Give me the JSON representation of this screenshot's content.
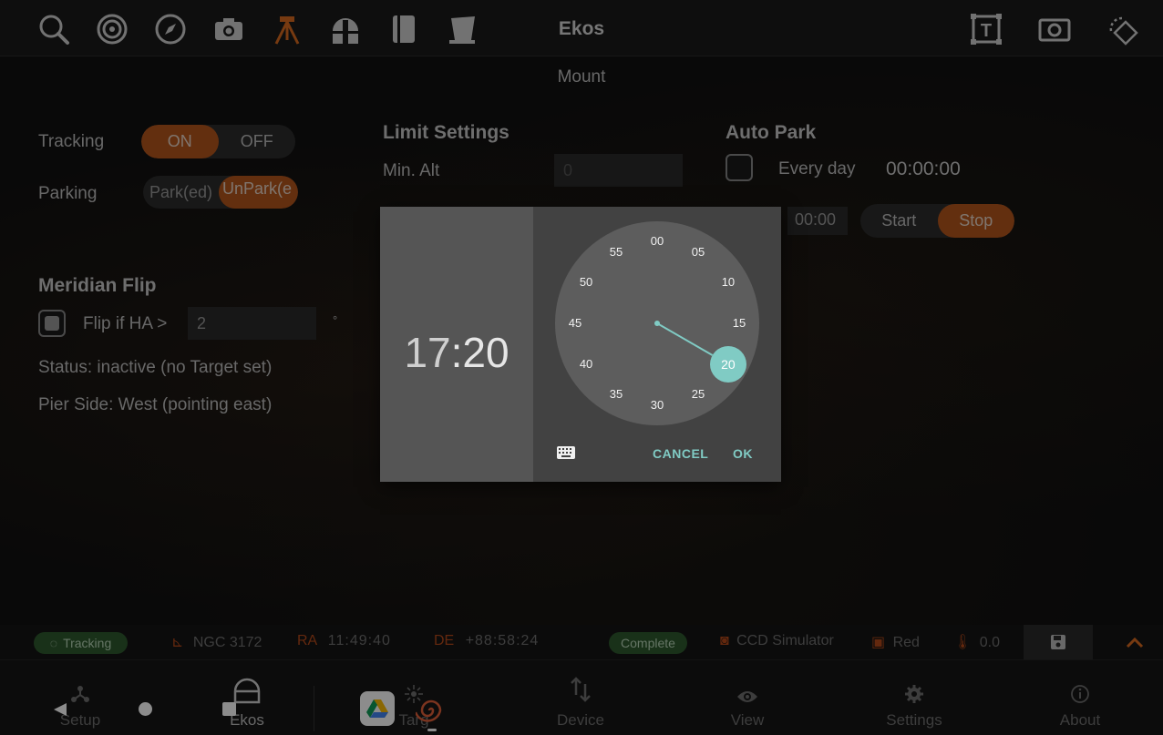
{
  "topbar": {
    "title": "Ekos",
    "icons": [
      "search-icon",
      "target-icon",
      "compass-icon",
      "camera-icon",
      "tripod-icon",
      "dome-icon",
      "notebook-icon",
      "flat-panel-icon",
      "text-frame-icon",
      "screen-capture-icon",
      "rotate-icon"
    ],
    "accent": "#d96a1f"
  },
  "page": {
    "subtitle": "Mount"
  },
  "tracking": {
    "label": "Tracking",
    "on": "ON",
    "off": "OFF"
  },
  "parking": {
    "label": "Parking",
    "park": "Park(ed)",
    "unpark": "UnPark(e"
  },
  "limits": {
    "heading": "Limit Settings",
    "min_alt_label": "Min. Alt",
    "min_alt_value": "0"
  },
  "autopark": {
    "heading": "Auto Park",
    "every_day": "Every day",
    "time": "00:00:00",
    "short_time": "00:00",
    "start": "Start",
    "stop": "Stop"
  },
  "meridian": {
    "heading": "Meridian Flip",
    "flip_label": "Flip if HA >",
    "flip_value": "2",
    "degree": "°",
    "status": "Status: inactive (no Target set)",
    "pier": "Pier Side: West (pointing east)"
  },
  "status": {
    "tracking": "Tracking",
    "target": "NGC 3172",
    "ra_label": "RA",
    "ra": "11:49:40",
    "de_label": "DE",
    "de": "+88:58:24",
    "complete": "Complete",
    "ccd": "CCD Simulator",
    "filter": "Red",
    "temp": "0.0"
  },
  "nav": {
    "setup": "Setup",
    "ekos": "Ekos",
    "target": "Targ",
    "device": "Device",
    "view": "View",
    "settings": "Settings",
    "about": "About"
  },
  "dialog": {
    "hour": "17",
    "sep": ":",
    "minute": "20",
    "cancel": "CANCEL",
    "ok": "OK",
    "numbers": [
      "00",
      "05",
      "10",
      "15",
      "20",
      "25",
      "30",
      "35",
      "40",
      "45",
      "50",
      "55"
    ],
    "selected": "20",
    "selected_color": "#80cbc4"
  }
}
